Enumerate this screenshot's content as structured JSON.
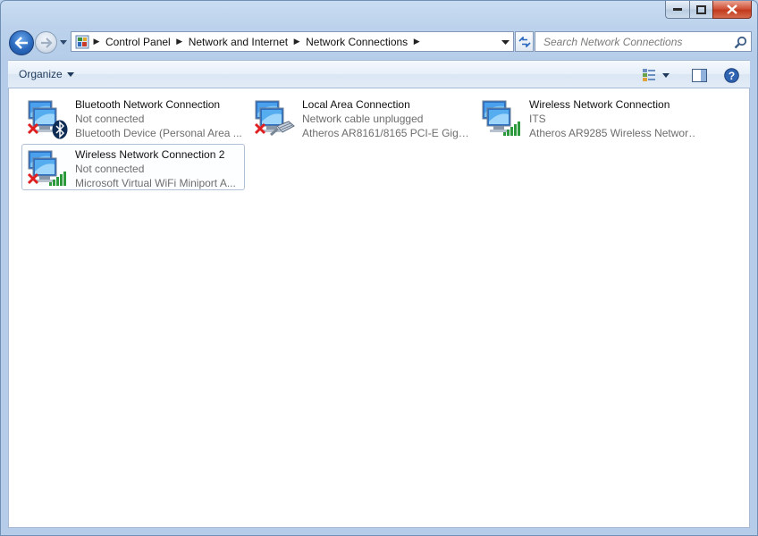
{
  "window": {
    "caption": {
      "minimize": "minimize-icon",
      "maximize": "maximize-icon",
      "close": "close-icon"
    }
  },
  "nav": {
    "breadcrumbs": [
      "Control Panel",
      "Network and Internet",
      "Network Connections"
    ],
    "search_placeholder": "Search Network Connections"
  },
  "toolbar": {
    "organize_label": "Organize",
    "icons": [
      "change-view-icon",
      "preview-pane-icon",
      "help-icon"
    ]
  },
  "connections": [
    {
      "name": "Bluetooth Network Connection",
      "status": "Not connected",
      "device": "Bluetooth Device (Personal Area ...",
      "overlay": "bluetooth",
      "disconnected": true,
      "selected": false
    },
    {
      "name": "Local Area Connection",
      "status": "Network cable unplugged",
      "device": "Atheros AR8161/8165 PCI-E Gigab...",
      "overlay": "ethernet",
      "disconnected": true,
      "selected": false
    },
    {
      "name": "Wireless Network Connection",
      "status": "ITS",
      "device": "Atheros AR9285 Wireless Network...",
      "overlay": "signal",
      "disconnected": false,
      "selected": false
    },
    {
      "name": "Wireless Network Connection 2",
      "status": "Not connected",
      "device": "Microsoft Virtual WiFi Miniport A...",
      "overlay": "signal",
      "disconnected": true,
      "selected": true
    }
  ],
  "colors": {
    "accent": "#2a68bd",
    "error_x": "#e02020",
    "signal": "#2c9a3c"
  }
}
